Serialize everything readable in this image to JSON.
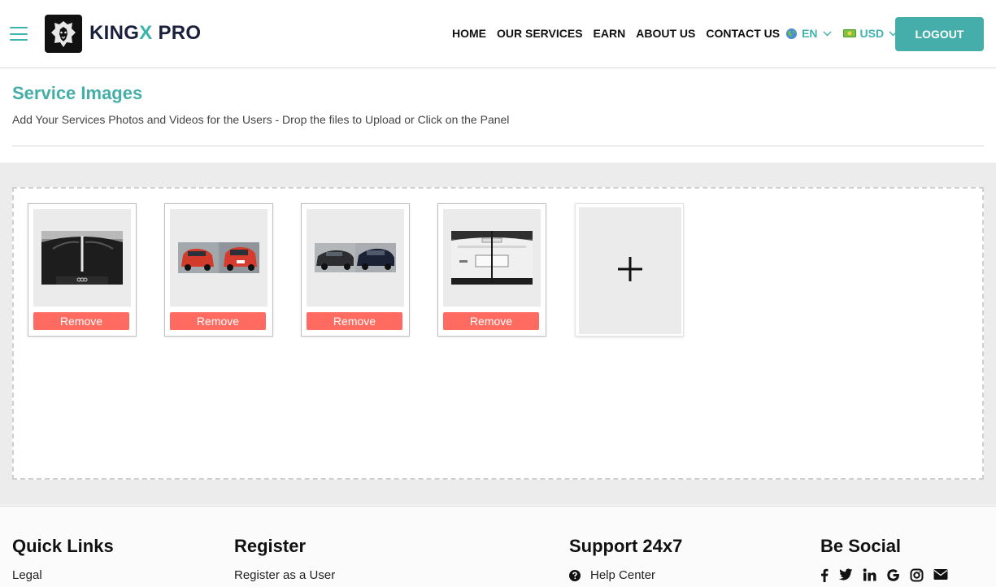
{
  "header": {
    "brand_part1": "KING",
    "brand_x": "X",
    "brand_part2": " PRO",
    "nav": [
      "HOME",
      "OUR SERVICES",
      "EARN",
      "ABOUT US",
      "CONTACT US"
    ],
    "language": "EN",
    "currency": "USD",
    "logout_label": "LOGOUT",
    "accent_color": "#45aeaa"
  },
  "main": {
    "title": "Service Images",
    "subtitle": "Add Your Services Photos and Videos for the Users - Drop the files to Upload or Click on the Panel",
    "remove_label": "Remove",
    "add_symbol": "+"
  },
  "footer": {
    "quick_links": {
      "heading": "Quick Links",
      "links": [
        "Legal"
      ]
    },
    "register": {
      "heading": "Register",
      "links": [
        "Register as a User"
      ]
    },
    "support": {
      "heading": "Support 24x7",
      "links": [
        "Help Center"
      ]
    },
    "social": {
      "heading": "Be Social",
      "icons": [
        "facebook-icon",
        "twitter-icon",
        "linkedin-icon",
        "google-icon",
        "instagram-icon",
        "envelope-icon"
      ]
    }
  }
}
